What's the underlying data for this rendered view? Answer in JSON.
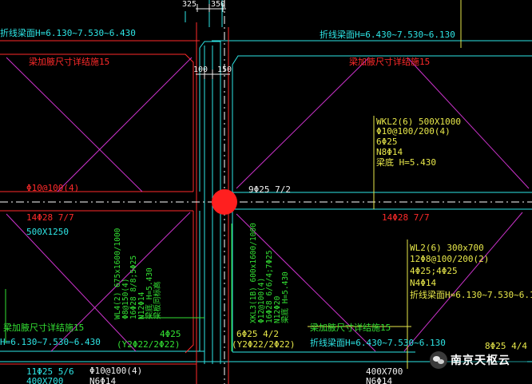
{
  "colors": {
    "background": "#000000",
    "beam_red": "#ff2a2a",
    "grid_cyan": "#2ee6e6",
    "dim_white": "#f0f0f0",
    "note_yellow": "#e8e84a",
    "note_green": "#33e033",
    "diag_magenta": "#cc33cc",
    "marker_red": "#ff1f1f"
  },
  "dimensions": {
    "d325": "325",
    "d350": "350",
    "d100": "100",
    "d150": "150"
  },
  "top_labels": {
    "left_slope": "折线梁面H=6.130~7.530~6.430",
    "right_slope": "折线梁面H=6.430~7.530~6.130"
  },
  "haunch_notes": {
    "top_left": "梁加腋尺寸详结施15",
    "top_right": "梁加腋尺寸详结施15",
    "bottom_left": "梁加腋尺寸详结施15",
    "bottom_right": "梁加腋尺寸详结施15"
  },
  "wkl2": {
    "l1": "WKL2(6) 500X1000",
    "l2": "Φ10@100/200(4)",
    "l3": "6Φ25",
    "l4": "N8Φ14",
    "l5": "梁底 H=5.430"
  },
  "left_stirrup": "Φ10@100(4)",
  "mid_rebar": "9Φ25 7/2",
  "left_bottom_rebar": "14Φ28 7/7",
  "right_bottom_rebar": "14Φ28 7/7",
  "left_section": "500X1250",
  "wl4": {
    "l1": "WL4(2) 675x1600/1000",
    "l2": "Φ8@150(4)",
    "l3": "16Φ28 8/8;5Φ25",
    "l4": "N12Φ14",
    "l5": "梁底 H=5.430",
    "l6": "梁板同标高"
  },
  "xkl3": {
    "l1": "XKL3(1B) 600x1600/1000",
    "l2": "Φ12@100(4)",
    "l3": "16Φ28 6/6/4;7Φ25",
    "l4": "N12Φ20",
    "l5": "梁底 H=5.430"
  },
  "wl2": {
    "l1": "WL2(6) 300x700",
    "l2": "12Φ8@100/200(2)",
    "l3": "4Φ25;4Φ25",
    "l4": "N4Φ14",
    "l5": "折线梁面H=6.130~7.530~6.130"
  },
  "bottom_left_slope": "H=6.130~7.530~6.430",
  "bottom_mid_slope": "折线梁面H=6.430~7.530~6.130",
  "rebar_4phi25": "4Φ25",
  "rebar_y2_left": "(Y2Φ22/2Φ22)",
  "rebar_6phi25": "6Φ25 4/2",
  "rebar_y2_mid": "(Y2Φ22/2Φ22)",
  "bottom_row": {
    "r11": "11Φ25 5/6",
    "stir": "Φ10@100(4)",
    "sec_left": "400X700",
    "sec_mid": "400X700",
    "n6": "N6Φ14",
    "n6b": "N6Φ14",
    "r8": "8Φ25 4/4"
  },
  "watermark": "南京天枢云"
}
